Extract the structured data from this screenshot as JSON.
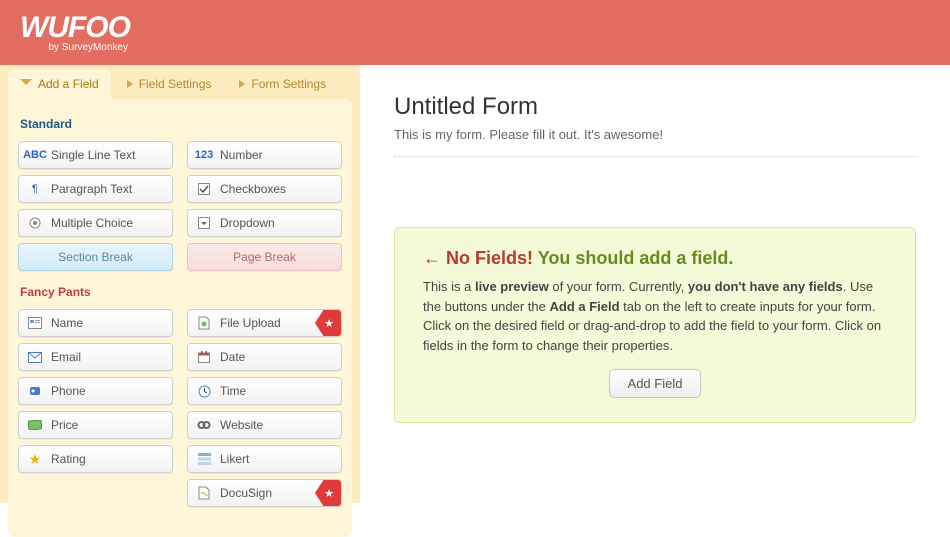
{
  "logo": {
    "main": "WUFOO",
    "sub": "by SurveyMonkey"
  },
  "tabs": [
    {
      "label": "Add a Field",
      "active": true
    },
    {
      "label": "Field Settings",
      "active": false
    },
    {
      "label": "Form Settings",
      "active": false
    }
  ],
  "sections": {
    "standard_label": "Standard",
    "fancy_label": "Fancy Pants"
  },
  "standard_fields": [
    {
      "label": "Single Line Text",
      "icon": "abc"
    },
    {
      "label": "Number",
      "icon": "123"
    },
    {
      "label": "Paragraph Text",
      "icon": "paragraph"
    },
    {
      "label": "Checkboxes",
      "icon": "checkbox"
    },
    {
      "label": "Multiple Choice",
      "icon": "radio"
    },
    {
      "label": "Dropdown",
      "icon": "dropdown"
    },
    {
      "label": "Section Break",
      "icon": "",
      "variant": "section-break"
    },
    {
      "label": "Page Break",
      "icon": "",
      "variant": "page-break"
    }
  ],
  "fancy_fields": [
    {
      "label": "Name",
      "icon": "name"
    },
    {
      "label": "File Upload",
      "icon": "file",
      "ribbon": true
    },
    {
      "label": "Email",
      "icon": "email"
    },
    {
      "label": "Date",
      "icon": "date"
    },
    {
      "label": "Phone",
      "icon": "phone"
    },
    {
      "label": "Time",
      "icon": "time"
    },
    {
      "label": "Price",
      "icon": "price"
    },
    {
      "label": "Website",
      "icon": "website"
    },
    {
      "label": "Rating",
      "icon": "rating"
    },
    {
      "label": "Likert",
      "icon": "likert"
    },
    {
      "label": "",
      "icon": "",
      "empty": true
    },
    {
      "label": "DocuSign",
      "icon": "docusign",
      "ribbon": true
    }
  ],
  "preview": {
    "title": "Untitled Form",
    "description": "This is my form. Please fill it out. It's awesome!",
    "notice": {
      "arrow": "←",
      "nofields": "No Fields!",
      "shouldadd": "You should add a field.",
      "body_pre": "This is a ",
      "body_live": "live preview",
      "body_mid": " of your form. Currently, ",
      "body_none": "you don't have any fields",
      "body_post1": ". Use the buttons under the ",
      "body_tab": "Add a Field",
      "body_post2": " tab on the left to create inputs for your form. Click on the desired field or drag-and-drop to add the field to your form. Click on fields in the form to change their properties.",
      "button": "Add Field"
    }
  }
}
